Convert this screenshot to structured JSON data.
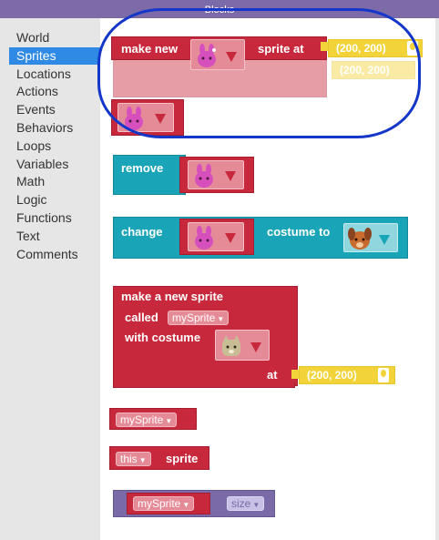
{
  "window": {
    "title": "Blocks"
  },
  "sidebar": {
    "categories": [
      "World",
      "Sprites",
      "Locations",
      "Actions",
      "Events",
      "Behaviors",
      "Loops",
      "Variables",
      "Math",
      "Logic",
      "Functions",
      "Text",
      "Comments"
    ],
    "selected": "Sprites"
  },
  "blocks": {
    "make_new_sprite_at": {
      "label1": "make new",
      "label2": "sprite at",
      "costume_icon": "pink-bunny-icon",
      "location": "(200, 200)"
    },
    "ghost_location": "(200, 200)",
    "sprite_only": {
      "costume_icon": "pink-bunny-icon"
    },
    "remove": {
      "label": "remove",
      "costume_icon": "pink-bunny-icon"
    },
    "change_costume": {
      "label1": "change",
      "label2": "costume to",
      "costume_icon": "pink-bunny-icon",
      "target_costume_icon": "brown-puppy-icon"
    },
    "make_named_sprite": {
      "line1": "make a new sprite",
      "called_label": "called",
      "variable": "mySprite",
      "costume_label": "with costume",
      "costume_icon": "tan-cat-icon",
      "at_label": "at",
      "location": "(200, 200)"
    },
    "variable_block": {
      "variable": "mySprite"
    },
    "this_sprite": {
      "keyword": "this",
      "label": "sprite"
    },
    "property_block": {
      "variable": "mySprite",
      "property": "size"
    }
  },
  "colors": {
    "sprite_red": "#c8283c",
    "action_teal": "#1aa4b8",
    "property_purple": "#7a6aa8",
    "location_yellow": "#f2d43a",
    "selected_category": "#2f8ae6",
    "annotation_circle": "#1537c9"
  }
}
